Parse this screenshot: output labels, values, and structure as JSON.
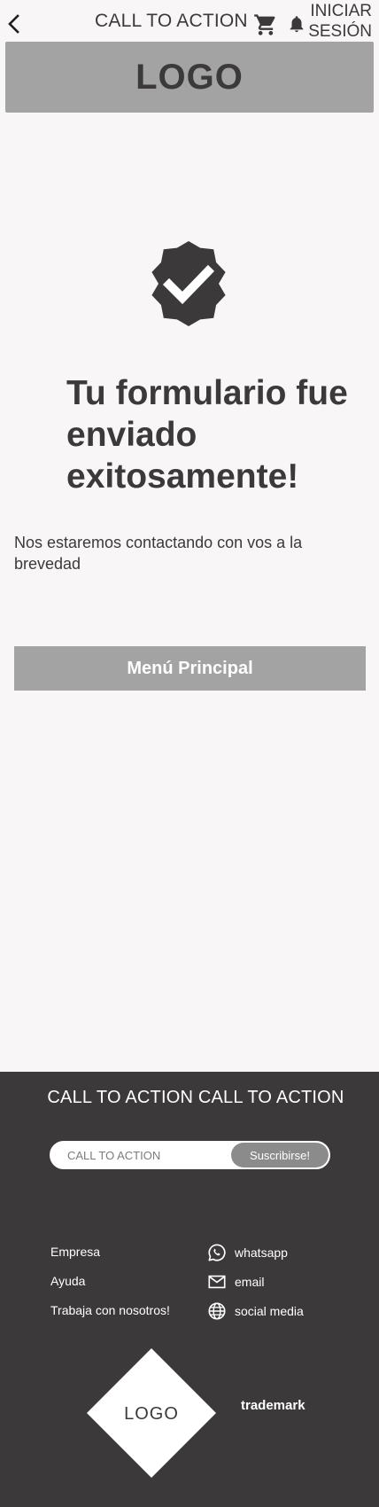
{
  "topbar": {
    "back_icon": "chevron-left-icon",
    "cta": "CALL TO ACTION",
    "cart_icon": "shopping-cart-icon",
    "bell_icon": "bell-icon",
    "login_line1": "INICIAR",
    "login_line2": "SESIÓN"
  },
  "banner": {
    "logo": "LOGO"
  },
  "success": {
    "badge_icon": "verified-check-badge-icon",
    "headline": "Tu formulario fue enviado exitosamente!",
    "message": "Nos estaremos contactando con vos a la brevedad",
    "button_label": "Menú Principal"
  },
  "footer": {
    "cta": "CALL TO ACTION CALL TO ACTION",
    "subscribe": {
      "placeholder": "CALL TO ACTION",
      "button_label": "Suscribirse!"
    },
    "links": [
      "Empresa",
      "Ayuda",
      "Trabaja con nosotros!"
    ],
    "contacts": [
      {
        "icon": "whatsapp-icon",
        "label": "whatsapp"
      },
      {
        "icon": "email-icon",
        "label": "email"
      },
      {
        "icon": "globe-icon",
        "label": "social media"
      }
    ],
    "logo": "LOGO",
    "trademark": "trademark"
  },
  "colors": {
    "page_background": "#f8f6f7",
    "text_dark": "#3b393a",
    "gray_block": "#a3a3a3",
    "footer_background": "#3b393a",
    "subscribe_button": "#8b8b8b"
  }
}
